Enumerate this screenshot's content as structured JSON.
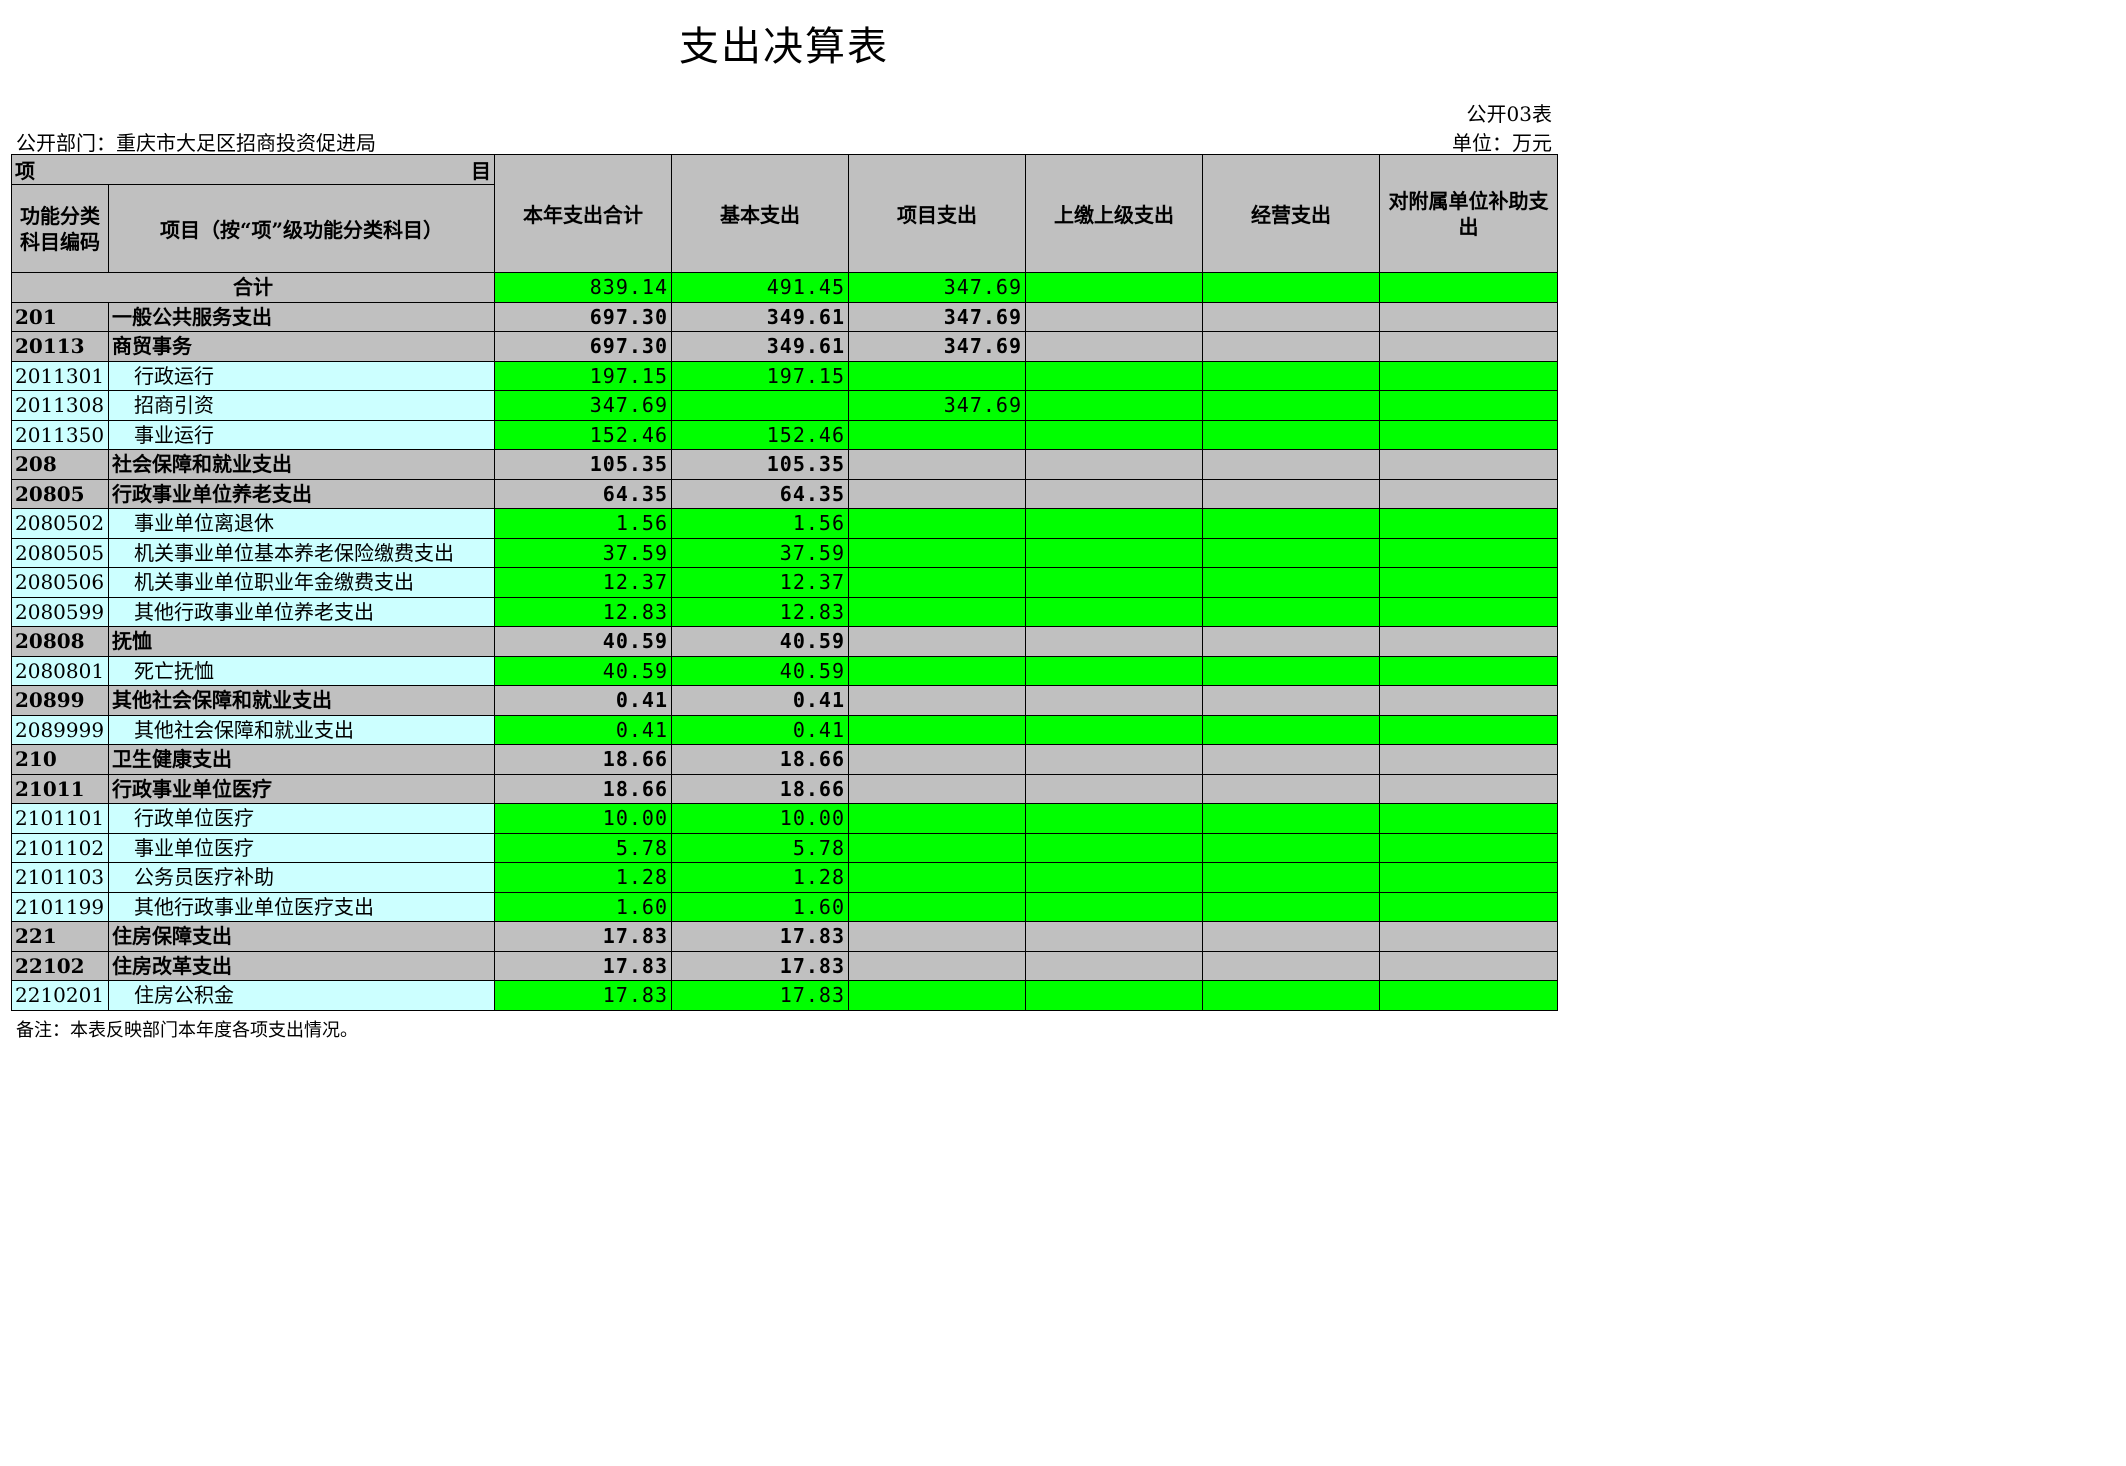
{
  "title": "支出决算表",
  "form_no": "公开03表",
  "department": "公开部门：重庆市大足区招商投资促进局",
  "unit": "单位：万元",
  "header": {
    "project_left": "项",
    "project_right": "目",
    "code_col": "功能分类科目编码",
    "name_col": "项目（按“项”级功能分类科目）",
    "columns": [
      "本年支出合计",
      "基本支出",
      "项目支出",
      "上缴上级支出",
      "经营支出",
      "对附属单位补助支出"
    ]
  },
  "total": {
    "label": "合计",
    "values": [
      "839.14",
      "491.45",
      "347.69",
      "",
      "",
      ""
    ]
  },
  "rows": [
    {
      "level": "cat",
      "code": "201",
      "name": "一般公共服务支出",
      "values": [
        "697.30",
        "349.61",
        "347.69",
        "",
        "",
        ""
      ]
    },
    {
      "level": "cat",
      "code": "20113",
      "name": "商贸事务",
      "values": [
        "697.30",
        "349.61",
        "347.69",
        "",
        "",
        ""
      ]
    },
    {
      "level": "item",
      "code": "2011301",
      "name": "行政运行",
      "values": [
        "197.15",
        "197.15",
        "",
        "",
        "",
        ""
      ]
    },
    {
      "level": "item",
      "code": "2011308",
      "name": "招商引资",
      "values": [
        "347.69",
        "",
        "347.69",
        "",
        "",
        ""
      ]
    },
    {
      "level": "item",
      "code": "2011350",
      "name": "事业运行",
      "values": [
        "152.46",
        "152.46",
        "",
        "",
        "",
        ""
      ]
    },
    {
      "level": "cat",
      "code": "208",
      "name": "社会保障和就业支出",
      "values": [
        "105.35",
        "105.35",
        "",
        "",
        "",
        ""
      ]
    },
    {
      "level": "cat",
      "code": "20805",
      "name": "行政事业单位养老支出",
      "values": [
        "64.35",
        "64.35",
        "",
        "",
        "",
        ""
      ]
    },
    {
      "level": "item",
      "code": "2080502",
      "name": "事业单位离退休",
      "values": [
        "1.56",
        "1.56",
        "",
        "",
        "",
        ""
      ]
    },
    {
      "level": "item",
      "code": "2080505",
      "name": "机关事业单位基本养老保险缴费支出",
      "values": [
        "37.59",
        "37.59",
        "",
        "",
        "",
        ""
      ]
    },
    {
      "level": "item",
      "code": "2080506",
      "name": "机关事业单位职业年金缴费支出",
      "values": [
        "12.37",
        "12.37",
        "",
        "",
        "",
        ""
      ]
    },
    {
      "level": "item",
      "code": "2080599",
      "name": "其他行政事业单位养老支出",
      "values": [
        "12.83",
        "12.83",
        "",
        "",
        "",
        ""
      ]
    },
    {
      "level": "cat",
      "code": "20808",
      "name": "抚恤",
      "values": [
        "40.59",
        "40.59",
        "",
        "",
        "",
        ""
      ]
    },
    {
      "level": "item",
      "code": "2080801",
      "name": "死亡抚恤",
      "values": [
        "40.59",
        "40.59",
        "",
        "",
        "",
        ""
      ]
    },
    {
      "level": "cat",
      "code": "20899",
      "name": "其他社会保障和就业支出",
      "values": [
        "0.41",
        "0.41",
        "",
        "",
        "",
        ""
      ]
    },
    {
      "level": "item",
      "code": "2089999",
      "name": "其他社会保障和就业支出",
      "values": [
        "0.41",
        "0.41",
        "",
        "",
        "",
        ""
      ]
    },
    {
      "level": "cat",
      "code": "210",
      "name": "卫生健康支出",
      "values": [
        "18.66",
        "18.66",
        "",
        "",
        "",
        ""
      ]
    },
    {
      "level": "cat",
      "code": "21011",
      "name": "行政事业单位医疗",
      "values": [
        "18.66",
        "18.66",
        "",
        "",
        "",
        ""
      ]
    },
    {
      "level": "item",
      "code": "2101101",
      "name": "行政单位医疗",
      "values": [
        "10.00",
        "10.00",
        "",
        "",
        "",
        ""
      ]
    },
    {
      "level": "item",
      "code": "2101102",
      "name": "事业单位医疗",
      "values": [
        "5.78",
        "5.78",
        "",
        "",
        "",
        ""
      ]
    },
    {
      "level": "item",
      "code": "2101103",
      "name": "公务员医疗补助",
      "values": [
        "1.28",
        "1.28",
        "",
        "",
        "",
        ""
      ]
    },
    {
      "level": "item",
      "code": "2101199",
      "name": "其他行政事业单位医疗支出",
      "values": [
        "1.60",
        "1.60",
        "",
        "",
        "",
        ""
      ]
    },
    {
      "level": "cat",
      "code": "221",
      "name": "住房保障支出",
      "values": [
        "17.83",
        "17.83",
        "",
        "",
        "",
        ""
      ]
    },
    {
      "level": "cat",
      "code": "22102",
      "name": "住房改革支出",
      "values": [
        "17.83",
        "17.83",
        "",
        "",
        "",
        ""
      ]
    },
    {
      "level": "item",
      "code": "2210201",
      "name": "住房公积金",
      "values": [
        "17.83",
        "17.83",
        "",
        "",
        "",
        ""
      ]
    }
  ],
  "note": "备注：本表反映部门本年度各项支出情况。"
}
